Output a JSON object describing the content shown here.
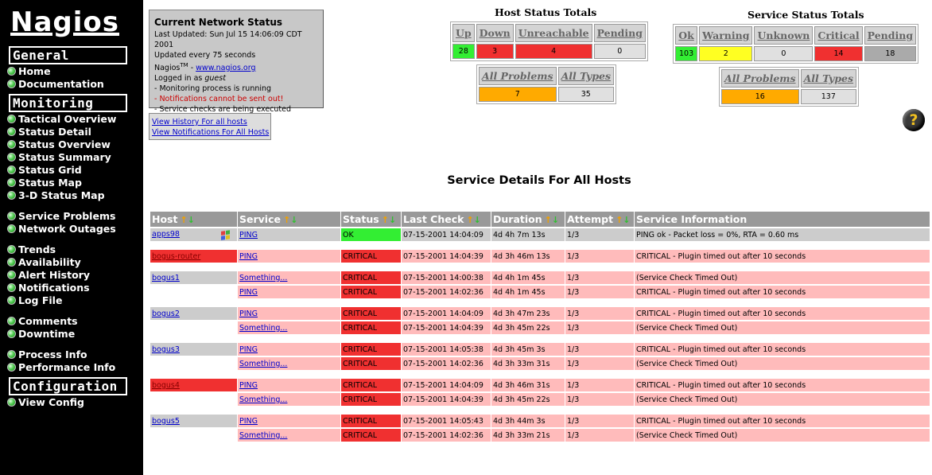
{
  "sidebar": {
    "logo": "Nagios",
    "sections": [
      {
        "title": "General",
        "items": [
          "Home",
          "Documentation"
        ]
      },
      {
        "title": "Monitoring",
        "items": [
          "Tactical Overview",
          "Status Detail",
          "Status Overview",
          "Status Summary",
          "Status Grid",
          "Status Map",
          "3-D Status Map",
          "Service Problems",
          "Network Outages",
          "Trends",
          "Availability",
          "Alert History",
          "Notifications",
          "Log File",
          "Comments",
          "Downtime",
          "Process Info",
          "Performance Info"
        ]
      },
      {
        "title": "Configuration",
        "items": [
          "View Config"
        ]
      }
    ]
  },
  "status": {
    "title": "Current Network Status",
    "last_updated": "Last Updated: Sun Jul 15 14:06:09 CDT 2001",
    "update_interval": "Updated every 75 seconds",
    "nagios_prefix": "Nagios",
    "tm": "TM",
    "dash": " - ",
    "nagios_link": "www.nagios.org",
    "logged_in_prefix": "Logged in as ",
    "logged_in_user": "guest",
    "lines": [
      "- Monitoring process is running",
      "- Notifications cannot be sent out!",
      "- Service checks are being executed"
    ]
  },
  "links": {
    "history": "View History For all hosts",
    "notifications": "View Notifications For All Hosts"
  },
  "host_totals": {
    "title": "Host Status Totals",
    "headers": [
      "Up",
      "Down",
      "Unreachable",
      "Pending"
    ],
    "values": [
      "28",
      "3",
      "4",
      "0"
    ],
    "colors": [
      "#33ee33",
      "#f03030",
      "#f03030",
      "#e0e0e0"
    ],
    "summary_headers": [
      "All Problems",
      "All Types"
    ],
    "summary_values": [
      "7",
      "35"
    ],
    "summary_colors": [
      "#ffaa00",
      "#e0e0e0"
    ]
  },
  "service_totals": {
    "title": "Service Status Totals",
    "headers": [
      "Ok",
      "Warning",
      "Unknown",
      "Critical",
      "Pending"
    ],
    "values": [
      "103",
      "2",
      "0",
      "14",
      "18"
    ],
    "colors": [
      "#33ee33",
      "#ffff22",
      "#e0e0e0",
      "#f03030",
      "#aaaaaa"
    ],
    "summary_headers": [
      "All Problems",
      "All Types"
    ],
    "summary_values": [
      "16",
      "137"
    ],
    "summary_colors": [
      "#ffaa00",
      "#e0e0e0"
    ]
  },
  "details": {
    "title": "Service Details For All Hosts",
    "columns": [
      "Host",
      "Service",
      "Status",
      "Last Check",
      "Duration",
      "Attempt",
      "Service Information"
    ],
    "sort_up": "↑",
    "sort_down": "↓",
    "rows": [
      {
        "host": "apps98",
        "host_state": "ok",
        "has_icon": true,
        "service": "PING",
        "status": "OK",
        "last_check": "07-15-2001 14:04:09",
        "duration": "4d 4h 7m 13s",
        "attempt": "1/3",
        "info": "PING ok - Packet loss = 0%, RTA = 0.60 ms",
        "group_start": true
      },
      {
        "host": "bogus-router",
        "host_state": "crit",
        "service": "PING",
        "status": "CRITICAL",
        "last_check": "07-15-2001 14:04:39",
        "duration": "4d 3h 46m 13s",
        "attempt": "1/3",
        "info": "CRITICAL - Plugin timed out after 10 seconds",
        "group_start": true
      },
      {
        "host": "bogus1",
        "host_state": "ok",
        "service": "Something...",
        "status": "CRITICAL",
        "last_check": "07-15-2001 14:00:38",
        "duration": "4d 4h 1m 45s",
        "attempt": "1/3",
        "info": "(Service Check Timed Out)",
        "group_start": true
      },
      {
        "host": "",
        "host_state": "none",
        "service": "PING",
        "status": "CRITICAL",
        "last_check": "07-15-2001 14:02:36",
        "duration": "4d 4h 1m 45s",
        "attempt": "1/3",
        "info": "CRITICAL - Plugin timed out after 10 seconds"
      },
      {
        "host": "bogus2",
        "host_state": "ok",
        "service": "PING",
        "status": "CRITICAL",
        "last_check": "07-15-2001 14:04:09",
        "duration": "4d 3h 47m 23s",
        "attempt": "1/3",
        "info": "CRITICAL - Plugin timed out after 10 seconds",
        "group_start": true
      },
      {
        "host": "",
        "host_state": "none",
        "service": "Something...",
        "status": "CRITICAL",
        "last_check": "07-15-2001 14:04:39",
        "duration": "4d 3h 45m 22s",
        "attempt": "1/3",
        "info": "(Service Check Timed Out)"
      },
      {
        "host": "bogus3",
        "host_state": "ok",
        "service": "PING",
        "status": "CRITICAL",
        "last_check": "07-15-2001 14:05:38",
        "duration": "4d 3h 45m 3s",
        "attempt": "1/3",
        "info": "CRITICAL - Plugin timed out after 10 seconds",
        "group_start": true
      },
      {
        "host": "",
        "host_state": "none",
        "service": "Something...",
        "status": "CRITICAL",
        "last_check": "07-15-2001 14:02:36",
        "duration": "4d 3h 33m 31s",
        "attempt": "1/3",
        "info": "(Service Check Timed Out)"
      },
      {
        "host": "bogus4",
        "host_state": "crit",
        "service": "PING",
        "status": "CRITICAL",
        "last_check": "07-15-2001 14:04:09",
        "duration": "4d 3h 46m 31s",
        "attempt": "1/3",
        "info": "CRITICAL - Plugin timed out after 10 seconds",
        "group_start": true
      },
      {
        "host": "",
        "host_state": "none",
        "service": "Something...",
        "status": "CRITICAL",
        "last_check": "07-15-2001 14:04:39",
        "duration": "4d 3h 45m 22s",
        "attempt": "1/3",
        "info": "(Service Check Timed Out)"
      },
      {
        "host": "bogus5",
        "host_state": "ok",
        "service": "PING",
        "status": "CRITICAL",
        "last_check": "07-15-2001 14:05:43",
        "duration": "4d 3h 44m 3s",
        "attempt": "1/3",
        "info": "CRITICAL - Plugin timed out after 10 seconds",
        "group_start": true
      },
      {
        "host": "",
        "host_state": "none",
        "service": "Something...",
        "status": "CRITICAL",
        "last_check": "07-15-2001 14:02:36",
        "duration": "4d 3h 33m 21s",
        "attempt": "1/3",
        "info": "(Service Check Timed Out)"
      }
    ]
  },
  "help": {
    "glyph": "?"
  }
}
